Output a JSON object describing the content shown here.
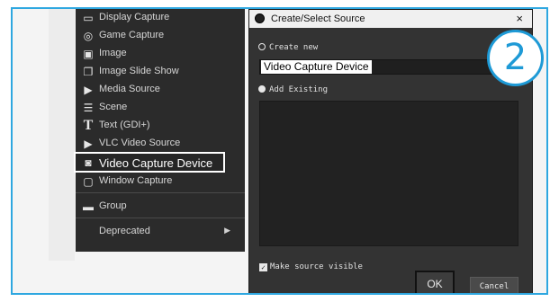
{
  "menu": {
    "items": [
      {
        "label": "Display Capture",
        "icon": "monitor-icon"
      },
      {
        "label": "Game Capture",
        "icon": "gamepad-icon"
      },
      {
        "label": "Image",
        "icon": "image-icon"
      },
      {
        "label": "Image Slide Show",
        "icon": "slideshow-icon"
      },
      {
        "label": "Media Source",
        "icon": "play-icon"
      },
      {
        "label": "Scene",
        "icon": "list-icon"
      },
      {
        "label": "Text (GDI+)",
        "icon": "text-icon"
      },
      {
        "label": "VLC Video Source",
        "icon": "play-icon"
      },
      {
        "label": "Video Capture Device",
        "icon": "camera-icon"
      },
      {
        "label": "Window Capture",
        "icon": "window-icon"
      },
      {
        "label": "Group",
        "icon": "folder-icon"
      },
      {
        "label": "Deprecated",
        "icon": "chevron-right-icon"
      }
    ]
  },
  "dialog": {
    "title": "Create/Select Source",
    "close_glyph": "×",
    "create_new_label": "Create new",
    "name_value": "Video Capture Device",
    "add_existing_label": "Add Existing",
    "make_visible_label": "Make source visible",
    "ok_label": "OK",
    "cancel_label": "Cancel"
  },
  "step": {
    "number": "2",
    "color": "#1e9ad6"
  }
}
